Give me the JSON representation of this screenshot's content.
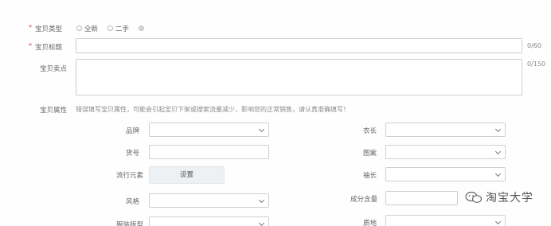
{
  "form": {
    "item_type": {
      "label": "宝贝类型",
      "options": [
        "全新",
        "二手"
      ]
    },
    "item_title": {
      "label": "宝贝标题",
      "counter": "0/60"
    },
    "selling_points": {
      "label": "宝贝卖点",
      "counter": "0/150"
    },
    "attributes": {
      "label": "宝贝属性",
      "hint": "错误填写宝贝属性，可能会引起宝贝下架或搜索流量减少，影响您的正常销售，请认真准确填写！",
      "left": [
        {
          "label": "品牌",
          "kind": "select"
        },
        {
          "label": "货号",
          "kind": "input"
        },
        {
          "label": "流行元素",
          "kind": "button",
          "button_label": "设置"
        },
        {
          "label": "风格",
          "kind": "select"
        },
        {
          "label": "服装版型",
          "kind": "select"
        }
      ],
      "right": [
        {
          "label": "衣长",
          "kind": "select"
        },
        {
          "label": "图案",
          "kind": "select"
        },
        {
          "label": "袖长",
          "kind": "select"
        },
        {
          "label": "成分含量",
          "kind": "input"
        },
        {
          "label": "质地",
          "kind": "select"
        }
      ]
    }
  },
  "watermark": {
    "text": "淘宝大学",
    "icon": "wechat-icon"
  },
  "colors": {
    "required_star": "#e23b3b",
    "border": "#cfcfcf",
    "button_bg": "#eef1f3"
  }
}
